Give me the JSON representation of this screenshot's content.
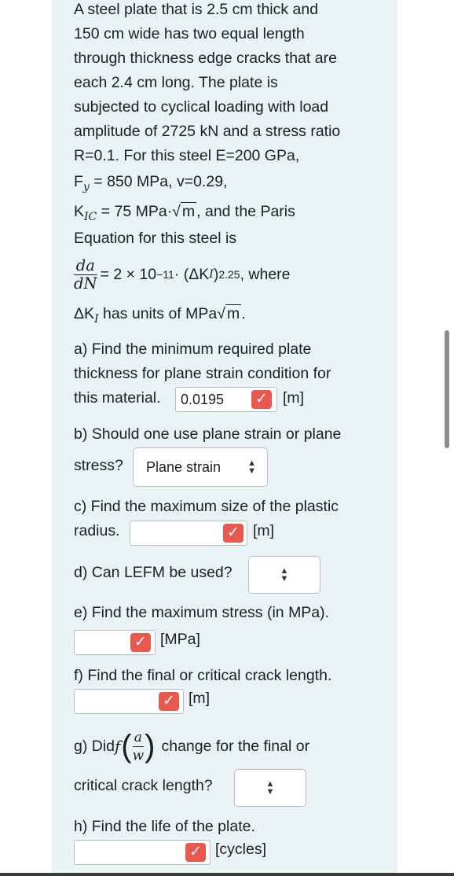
{
  "problem": {
    "line1": "A steel plate that is 2.5 cm thick and",
    "line2": "150 cm wide has two equal length",
    "line3": "through thickness edge cracks that are",
    "line4": "each 2.4 cm long. The plate is",
    "line5": "subjected to cyclical loading with load",
    "line6": "amplitude of 2725 kN and a stress ratio",
    "line7": "R=0.1. For this steel E=200 GPa,",
    "fy_sym": "F",
    "fy_sub": "y",
    "fy_rest": " = 850 MPa, v=0.29,",
    "kic_sym": "K",
    "kic_sub": "IC",
    "kic_rest": " = 75 MPa·√",
    "kic_m": "m",
    "kic_tail": ", and the Paris",
    "paris_intro": "Equation for this steel is",
    "da": "da",
    "dn": "dN",
    "paris_eq": "= 2 × 10",
    "paris_exp": "−11",
    "paris_mid": " · (ΔK",
    "paris_sub": "I",
    "paris_close": ")",
    "paris_pow": "2.25",
    "paris_tail": ", where",
    "units_line_a": "ΔK",
    "units_sub": "I",
    "units_line_b": " has units of MPa√",
    "units_m": "m",
    "units_dot": "."
  },
  "parts": {
    "a_line1": "a) Find the minimum required plate",
    "a_line2": "thickness for plane strain condition for",
    "a_line3": "this material.",
    "a_value": "0.0195",
    "a_unit": "[m]",
    "b_line1": "b) Should one use plane strain or plane",
    "b_line2": "stress?",
    "b_selected": "Plane strain",
    "c_line1": "c) Find the maximum size of the plastic",
    "c_line2": "radius.",
    "c_unit": "[m]",
    "d_line1": "d) Can LEFM be used?",
    "e_line1": "e) Find the maximum stress (in MPa).",
    "e_unit": "[MPa]",
    "f_line1": "f) Find the final or critical crack length.",
    "f_unit": "[m]",
    "g_prefix": "g) Did ",
    "g_f": "f",
    "g_a": "a",
    "g_w": "w",
    "g_suffix": "change for the final or",
    "g_line2": "critical crack length?",
    "h_line1": "h) Find the life of the plate.",
    "h_unit": "[cycles]"
  },
  "icons": {
    "check": "checkmark-icon",
    "caret": "updown-caret-icon"
  },
  "colors": {
    "panel": "#e9f2f5",
    "check_badge": "#e8584f"
  }
}
